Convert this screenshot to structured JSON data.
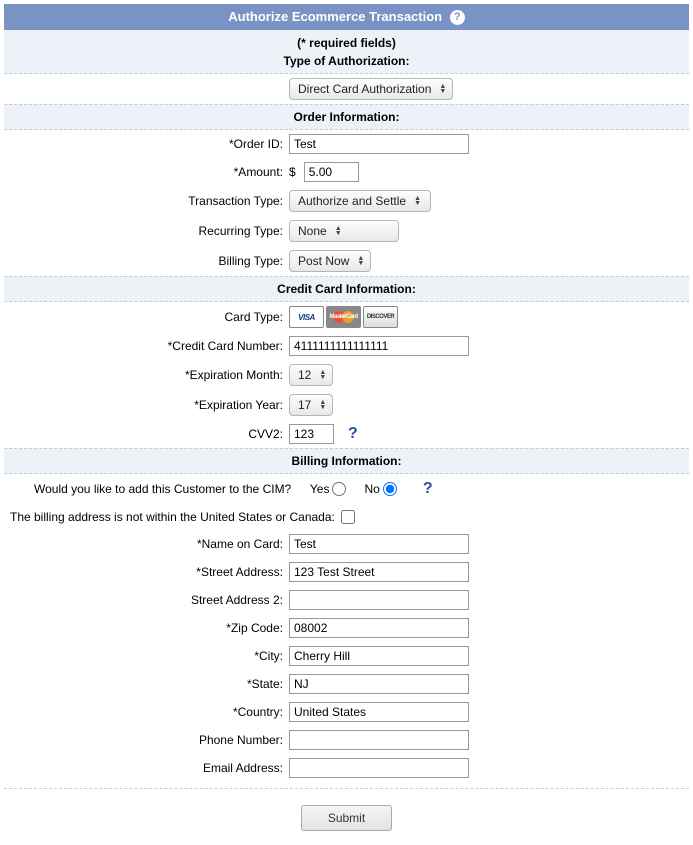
{
  "title": "Authorize Ecommerce Transaction",
  "required_note": "(* required fields)",
  "sections": {
    "auth_type": "Type of Authorization:",
    "order_info": "Order Information:",
    "cc_info": "Credit Card Information:",
    "billing_info": "Billing Information:"
  },
  "fields": {
    "auth_select": "Direct Card Authorization",
    "order_id": {
      "label": "*Order ID:",
      "value": "Test"
    },
    "amount": {
      "label": "*Amount:",
      "currency": "$",
      "value": "5.00"
    },
    "txn_type": {
      "label": "Transaction Type:",
      "value": "Authorize and Settle"
    },
    "recurring": {
      "label": "Recurring Type:",
      "value": "None"
    },
    "billing_type": {
      "label": "Billing Type:",
      "value": "Post Now"
    },
    "card_type": {
      "label": "Card Type:"
    },
    "cc_number": {
      "label": "*Credit Card Number:",
      "value": "4111111111111111"
    },
    "exp_month": {
      "label": "*Expiration Month:",
      "value": "12"
    },
    "exp_year": {
      "label": "*Expiration Year:",
      "value": "17"
    },
    "cvv2": {
      "label": "CVV2:",
      "value": "123"
    },
    "cim_question": "Would you like to add this Customer to the CIM?",
    "cim_yes": "Yes",
    "cim_no": "No",
    "outside_us": "The billing address is not within the United States or Canada:",
    "name_on_card": {
      "label": "*Name on Card:",
      "value": "Test"
    },
    "street1": {
      "label": "*Street Address:",
      "value": "123 Test Street"
    },
    "street2": {
      "label": "Street Address 2:",
      "value": ""
    },
    "zip": {
      "label": "*Zip Code:",
      "value": "08002"
    },
    "city": {
      "label": "*City:",
      "value": "Cherry Hill"
    },
    "state": {
      "label": "*State:",
      "value": "NJ"
    },
    "country": {
      "label": "*Country:",
      "value": "United States"
    },
    "phone": {
      "label": "Phone Number:",
      "value": ""
    },
    "email": {
      "label": "Email Address:",
      "value": ""
    }
  },
  "submit_label": "Submit",
  "card_logos": {
    "visa": "VISA",
    "mc": "MasterCard",
    "disc": "DISCOVER"
  }
}
